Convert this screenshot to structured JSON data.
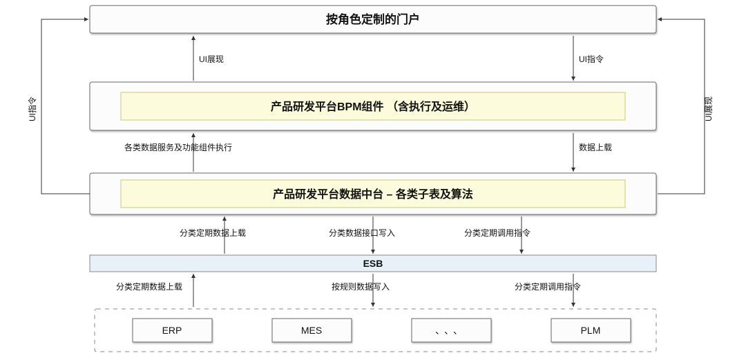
{
  "diagram": {
    "top_box": "按角色定制的门户",
    "bpm_box": "产品研发平台BPM组件 （含执行及运维）",
    "data_platform_box": "产品研发平台数据中台   –   各类子表及算法",
    "esb_box": "ESB",
    "systems": {
      "erp": "ERP",
      "mes": "MES",
      "dots": "、、、",
      "plm": "PLM"
    },
    "labels": {
      "ui_command_left": "UI指令",
      "ui_show_right": "UI展现",
      "ui_show_mid": "UI展现",
      "ui_command_mid": "UI指令",
      "bpm_up_left": "各类数据服务及功能组件执行",
      "bpm_down_right": "数据上载",
      "p_to_esb_1": "分类定期数据上载",
      "p_to_esb_2": "分类数据接口写入",
      "p_to_esb_3": "分类定期调用指令",
      "esb_to_sys_1": "分类定期数据上载",
      "esb_to_sys_2": "按规则数据写入",
      "esb_to_sys_3": "分类定期调用指令"
    }
  }
}
